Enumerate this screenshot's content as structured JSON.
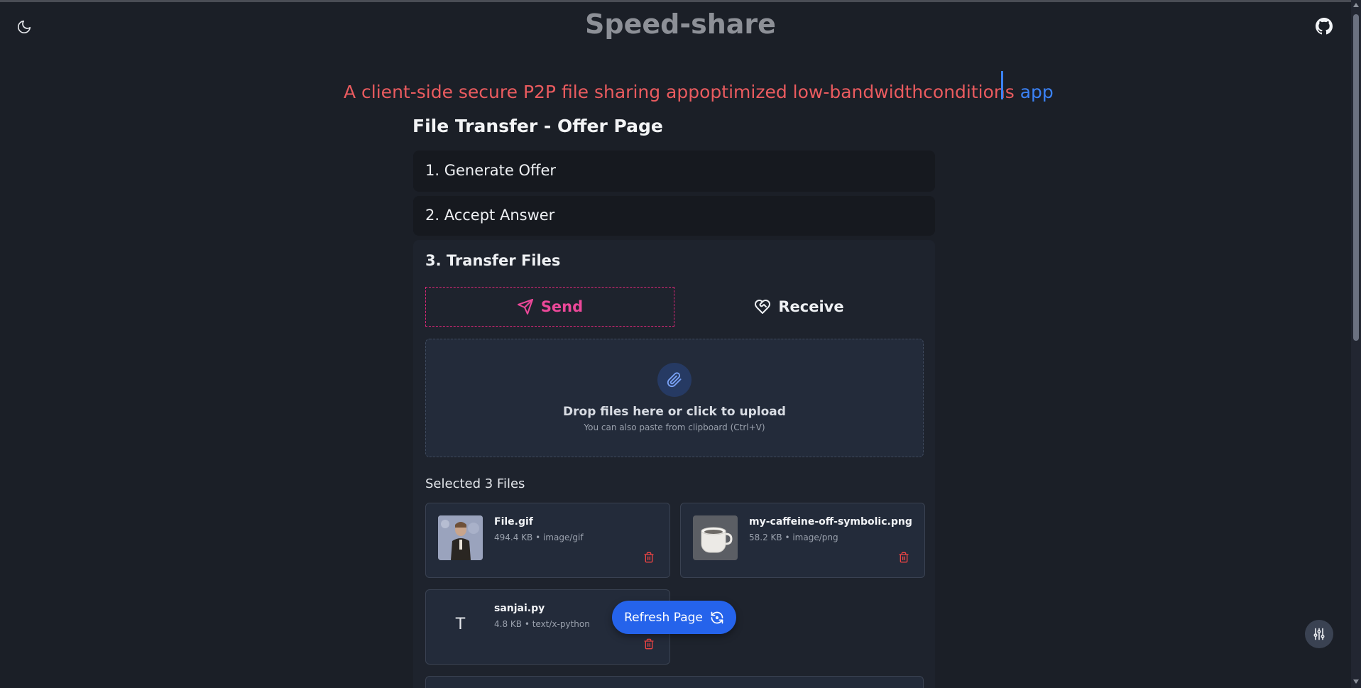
{
  "header": {
    "title": "Speed-share",
    "theme_icon": "moon-icon",
    "github_icon": "github-icon"
  },
  "tagline": {
    "text": "A client-side secure P2P file sharing appoptimized low-bandwidthconditions",
    "highlight": "app"
  },
  "page": {
    "heading": "File Transfer - Offer Page"
  },
  "steps": [
    {
      "label": "1. Generate Offer"
    },
    {
      "label": "2. Accept Answer"
    },
    {
      "label": "3. Transfer Files"
    }
  ],
  "transfer": {
    "send_label": "Send",
    "receive_label": "Receive",
    "active_tab": "Send",
    "dropzone": {
      "title": "Drop files here or click to upload",
      "subtitle": "You can also paste from clipboard (Ctrl+V)",
      "icon": "paperclip-icon"
    },
    "selected_title": "Selected 3 Files",
    "files": [
      {
        "name": "File.gif",
        "meta": "494.4 KB • image/gif",
        "thumb": "image-thumbnail"
      },
      {
        "name": "my-caffeine-off-symbolic.png",
        "meta": "58.2 KB • image/png",
        "thumb": "cup-icon"
      },
      {
        "name": "sanjai.py",
        "meta": "4.8 KB • text/x-python",
        "thumb_letter": "T"
      }
    ]
  },
  "refresh": {
    "label": "Refresh Page",
    "icon": "refresh-icon"
  },
  "colors": {
    "background": "#1b1f27",
    "accent_pink": "#ec4899",
    "accent_blue": "#2563eb",
    "tagline_red": "#ea5b5f"
  }
}
